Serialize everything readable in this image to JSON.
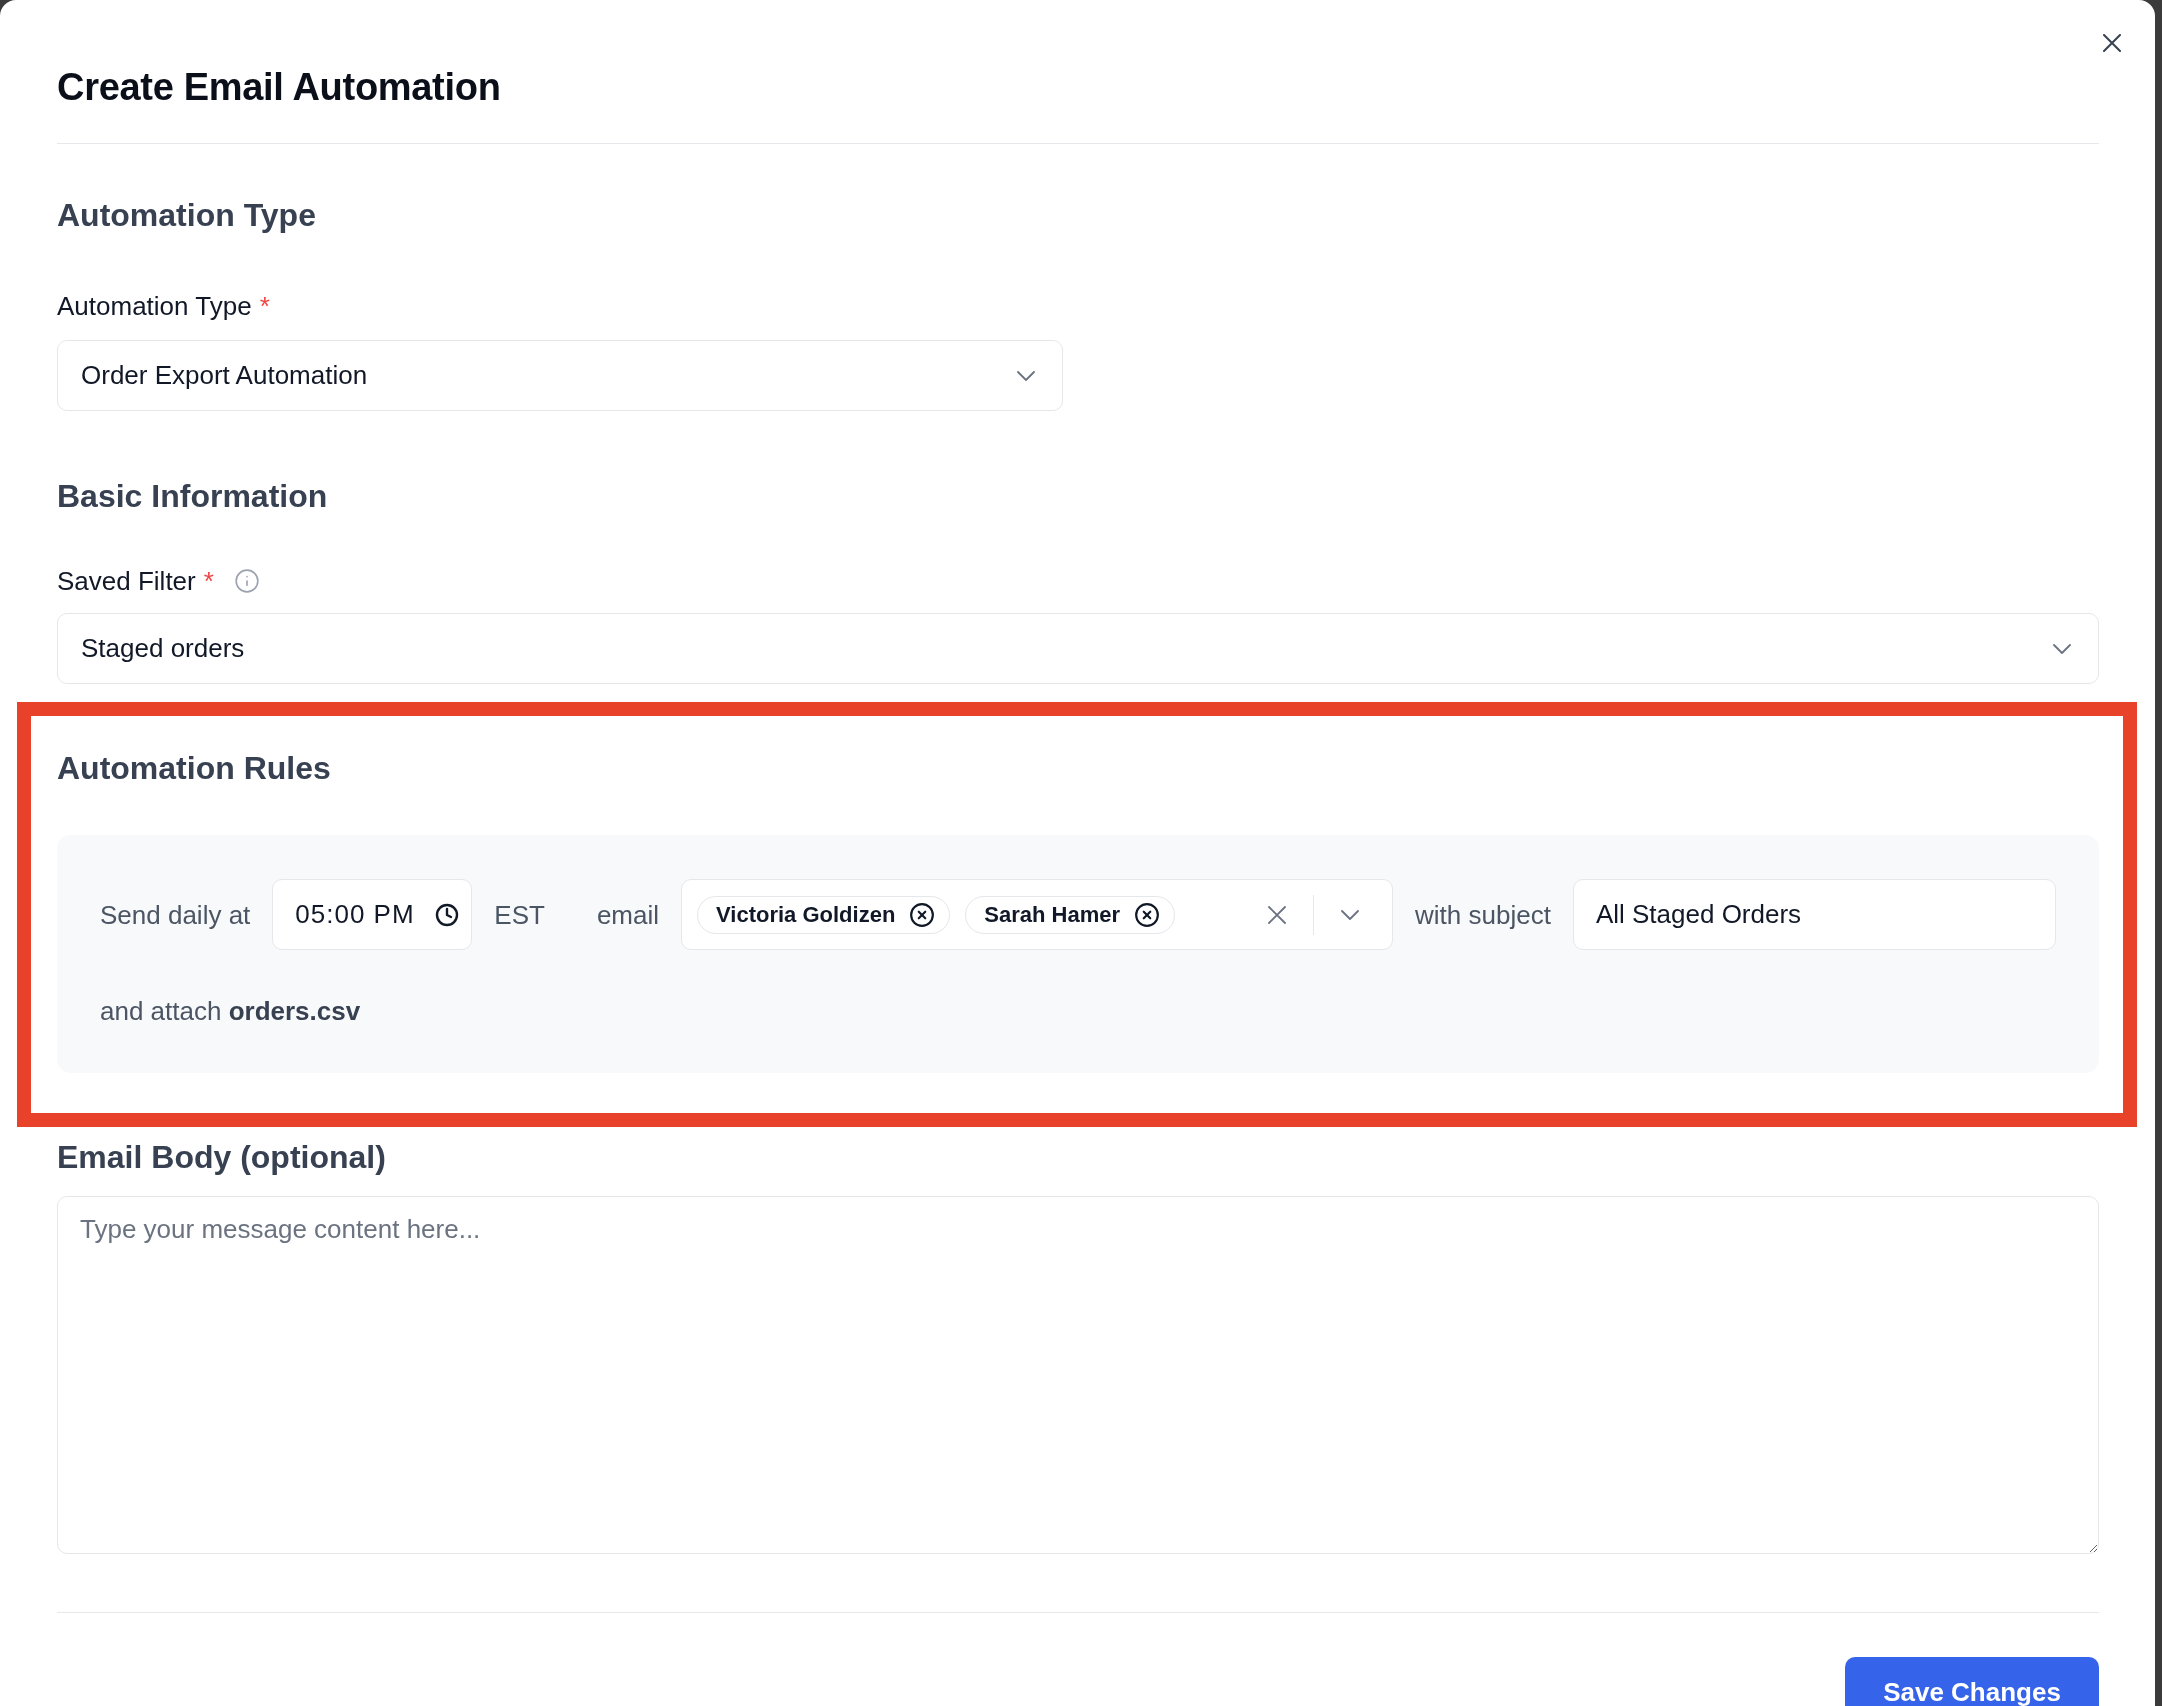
{
  "dialog": {
    "title": "Create Email Automation"
  },
  "automation_type": {
    "heading": "Automation Type",
    "field": {
      "label": "Automation Type",
      "required_mark": "*",
      "value": "Order Export Automation"
    }
  },
  "basic_information": {
    "heading": "Basic Information",
    "field": {
      "label": "Saved Filter",
      "required_mark": "*",
      "info": true,
      "value": "Staged orders"
    }
  },
  "automation_rules": {
    "heading": "Automation Rules",
    "highlighted": true,
    "parts": [
      {
        "kind": "text",
        "text": "Send daily at"
      },
      {
        "kind": "time",
        "value": "05:00 PM"
      },
      {
        "kind": "text",
        "text": "EST"
      },
      {
        "kind": "text",
        "text": "email"
      },
      {
        "kind": "recipients",
        "chips": [
          {
            "name": "Victoria Goldizen"
          },
          {
            "name": "Sarah Hamer"
          }
        ]
      },
      {
        "kind": "text",
        "text": "with subject"
      },
      {
        "kind": "input",
        "value": "All Staged Orders"
      },
      {
        "kind": "text",
        "text": "and attach **orders.csv**"
      }
    ]
  },
  "email_body": {
    "heading": "Email Body (optional)",
    "placeholder": "Type your message content here..."
  },
  "footer": {
    "button": "Save Changes"
  }
}
